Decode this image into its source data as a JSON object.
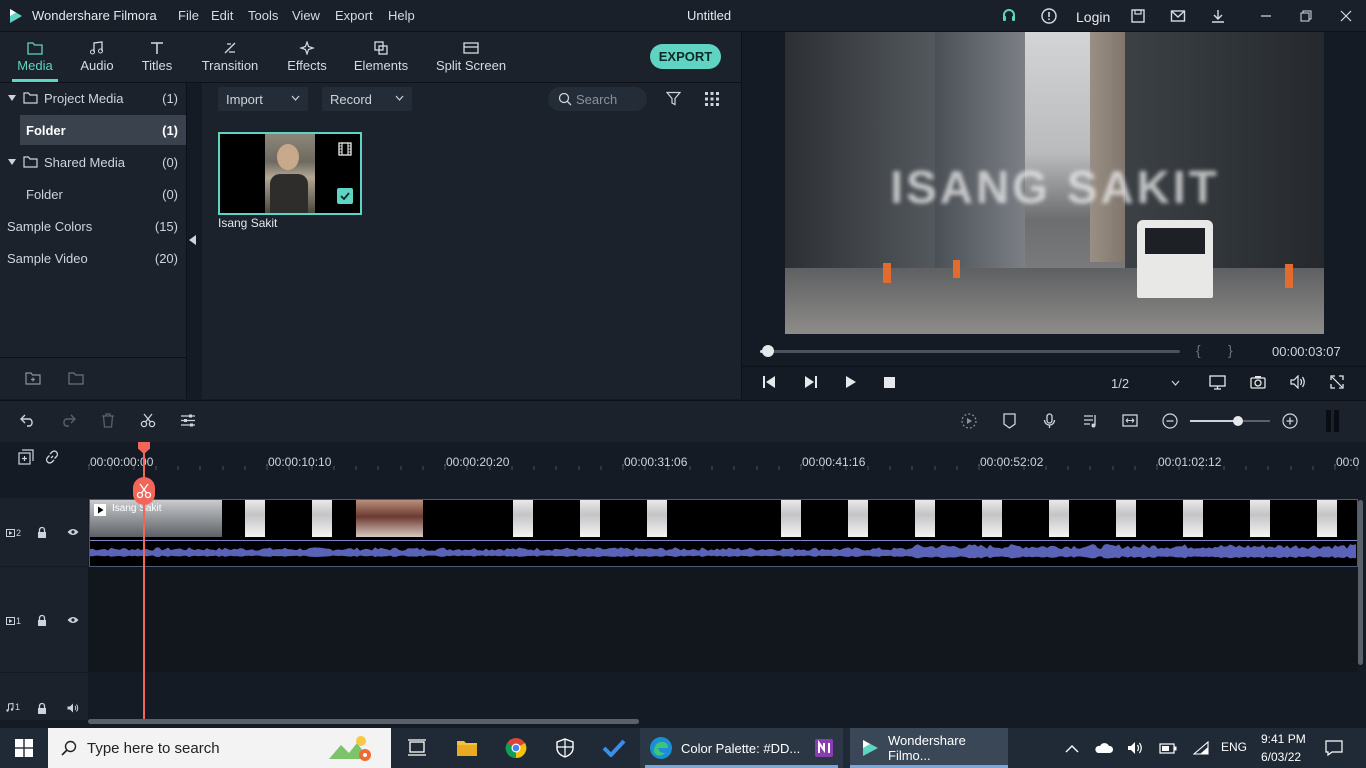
{
  "app": {
    "name": "Wondershare Filmora",
    "doc_title": "Untitled",
    "login_label": "Login"
  },
  "menu": [
    "File",
    "Edit",
    "Tools",
    "View",
    "Export",
    "Help"
  ],
  "tabs": [
    {
      "label": "Media",
      "icon": "folder-icon",
      "active": true
    },
    {
      "label": "Audio",
      "icon": "music-note-icon"
    },
    {
      "label": "Titles",
      "icon": "text-icon"
    },
    {
      "label": "Transition",
      "icon": "transition-icon"
    },
    {
      "label": "Effects",
      "icon": "sparkle-icon"
    },
    {
      "label": "Elements",
      "icon": "elements-icon"
    },
    {
      "label": "Split Screen",
      "icon": "split-screen-icon"
    }
  ],
  "export_label": "EXPORT",
  "sidebar": {
    "items": [
      {
        "label": "Project Media",
        "count": "(1)"
      },
      {
        "label": "Folder",
        "count": "(1)"
      },
      {
        "label": "Shared Media",
        "count": "(0)"
      },
      {
        "label": "Folder",
        "count": "(0)"
      },
      {
        "label": "Sample Colors",
        "count": "(15)"
      },
      {
        "label": "Sample Video",
        "count": "(20)"
      }
    ]
  },
  "media": {
    "import_label": "Import",
    "record_label": "Record",
    "search_placeholder": "Search",
    "clip_name": "Isang Sakit"
  },
  "preview": {
    "overlay_text": "ISANG SAKIT",
    "timecode": "00:00:03:07",
    "quality": "1/2",
    "bracket_in": "{",
    "bracket_out": "}",
    "progress": 0.02
  },
  "timeline": {
    "ruler_labels": [
      "00:00:00:00",
      "00:00:10:10",
      "00:00:20:20",
      "00:00:31:06",
      "00:00:41:16",
      "00:00:52:02",
      "00:01:02:12",
      "00:0"
    ],
    "clip_label": "Isang Sakit",
    "zoom_level": 0.6,
    "tracks": [
      "2",
      "1",
      "1"
    ]
  },
  "taskbar": {
    "search_placeholder": "Type here to search",
    "apps": [
      {
        "label": "Color Palette: #DD..."
      },
      {
        "label": "Wondershare Filmo..."
      }
    ],
    "language": "ENG",
    "time": "9:41 PM",
    "date": "6/03/22"
  },
  "colors": {
    "accent": "#5fd4c2",
    "playhead": "#f2665a",
    "panel": "#1b222c",
    "background": "#151b24",
    "audio_wave": "#5b63b8"
  }
}
